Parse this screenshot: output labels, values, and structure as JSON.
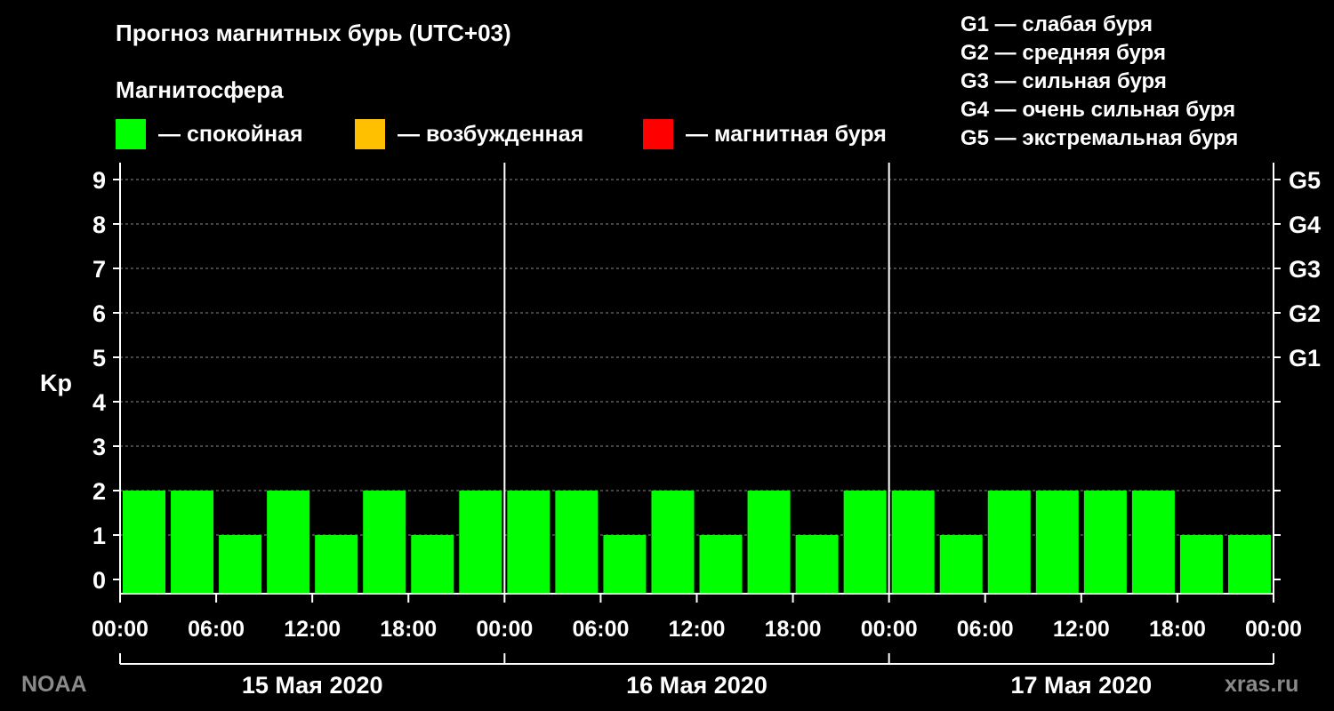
{
  "title": "Прогноз магнитных бурь (UTC+03)",
  "magnetosphere_label": "Магнитосфера",
  "legend": [
    {
      "text": "— спокойная",
      "color": "#00ff00"
    },
    {
      "text": "— возбужденная",
      "color": "#ffc000"
    },
    {
      "text": "— магнитная буря",
      "color": "#ff0000"
    }
  ],
  "g_legend": [
    "G1 — слабая буря",
    "G2 — средняя буря",
    "G3 — сильная буря",
    "G4 — очень сильная буря",
    "G5 — экстремальная буря"
  ],
  "source_left": "NOAA",
  "source_right": "xras.ru",
  "chart_data": {
    "type": "bar",
    "ylabel": "Kp",
    "ylim": [
      0,
      9
    ],
    "yticks": [
      "0",
      "1",
      "2",
      "3",
      "4",
      "5",
      "6",
      "7",
      "8",
      "9"
    ],
    "right_ticks": [
      {
        "kp": 5,
        "label": "G1"
      },
      {
        "kp": 6,
        "label": "G2"
      },
      {
        "kp": 7,
        "label": "G3"
      },
      {
        "kp": 8,
        "label": "G4"
      },
      {
        "kp": 9,
        "label": "G5"
      }
    ],
    "grid": true,
    "x_tick_labels": [
      "00:00",
      "06:00",
      "12:00",
      "18:00",
      "00:00",
      "06:00",
      "12:00",
      "18:00",
      "00:00",
      "06:00",
      "12:00",
      "18:00",
      "00:00"
    ],
    "days": [
      "15 Мая 2020",
      "16 Мая 2020",
      "17 Мая 2020"
    ],
    "bar_color": "#00ff00",
    "values": [
      2,
      2,
      1,
      2,
      1,
      2,
      1,
      2,
      2,
      2,
      1,
      2,
      1,
      2,
      1,
      2,
      2,
      1,
      2,
      2,
      2,
      2,
      1,
      1
    ]
  }
}
